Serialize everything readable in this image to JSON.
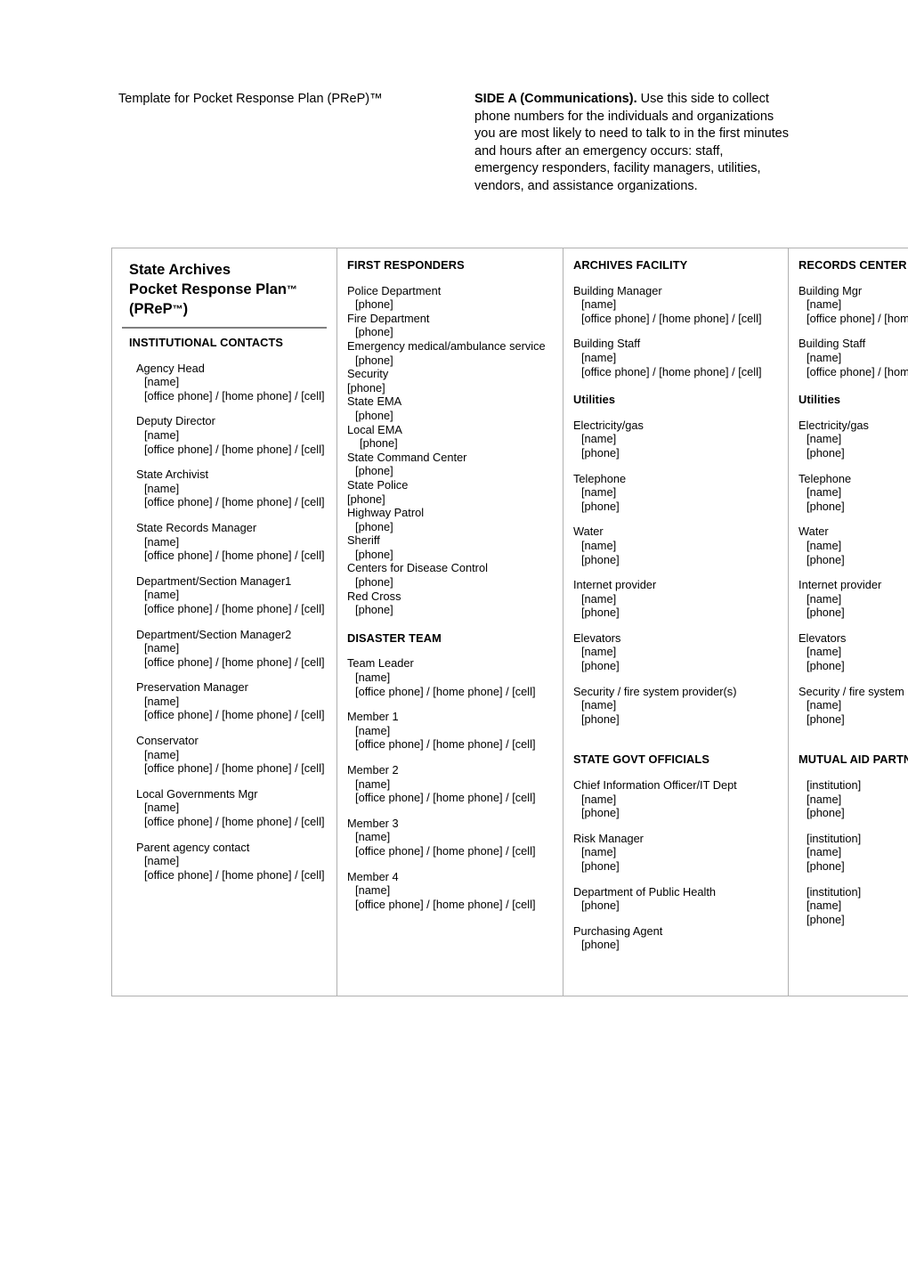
{
  "header": {
    "left_title": "Template for Pocket Response Plan (PReP)™",
    "side_label": "SIDE A (Communications).",
    "side_text": " Use this side to collect phone numbers for the individuals and organizations you are most likely to need to talk to in the first minutes and hours after an emergency occurs: staff, emergency responders, facility managers, utilities, vendors, and assistance organizations."
  },
  "card": {
    "title_line_1": "State Archives",
    "title_line_2": "Pocket Response Plan",
    "title_line_2_tm": "™",
    "title_line_3_open": "(PReP",
    "title_line_3_tm": "™",
    "title_line_3_close": ")"
  },
  "columns": [
    {
      "id": "institutional-contacts",
      "heading": "INSTITUTIONAL CONTACTS",
      "entries": [
        {
          "label": "Agency Head",
          "lines": [
            "[name]",
            "[office phone] / [home phone] / [cell]"
          ]
        },
        {
          "label": "Deputy Director",
          "lines": [
            "[name]",
            "[office phone] / [home phone] / [cell]"
          ]
        },
        {
          "label": "State Archivist",
          "lines": [
            "[name]",
            "[office phone] / [home phone] / [cell]"
          ]
        },
        {
          "label": "State Records Manager",
          "lines": [
            "[name]",
            "[office phone] / [home phone] / [cell]"
          ]
        },
        {
          "label": "Department/Section Manager1",
          "lines": [
            "[name]",
            "[office phone] / [home phone] / [cell]"
          ]
        },
        {
          "label": "Department/Section Manager2",
          "lines": [
            "[name]",
            "[office phone] / [home phone] / [cell]"
          ]
        },
        {
          "label": "Preservation Manager",
          "lines": [
            "[name]",
            "[office phone] / [home phone] / [cell]"
          ]
        },
        {
          "label": "Conservator",
          "lines": [
            "[name]",
            "[office phone] / [home phone] / [cell]"
          ]
        },
        {
          "label": "Local Governments Mgr",
          "lines": [
            "[name]",
            "[office phone] / [home phone] / [cell]"
          ]
        },
        {
          "label": "Parent agency contact",
          "lines": [
            "[name]",
            "[office phone] / [home phone] / [cell]"
          ]
        }
      ]
    },
    {
      "id": "first-responders",
      "heading": "FIRST RESPONDERS",
      "entries": [
        {
          "label": "Police Department",
          "lines": [
            "[phone]"
          ]
        },
        {
          "label": "Fire Department",
          "lines": [
            "[phone]"
          ]
        },
        {
          "label": "Emergency medical/ambulance service",
          "lines": [
            "[phone]"
          ]
        },
        {
          "label": "Security",
          "lines": [
            "[phone]"
          ],
          "flush": true
        },
        {
          "label": "State EMA",
          "lines": [
            "[phone]"
          ]
        },
        {
          "label": "Local EMA",
          "lines": [
            "[phone]"
          ],
          "deep": true
        },
        {
          "label": "State Command Center",
          "lines": [
            "[phone]"
          ]
        },
        {
          "label": "State Police",
          "lines": [
            "[phone]"
          ],
          "flush": true
        },
        {
          "label": "Highway Patrol",
          "lines": [
            "[phone]"
          ]
        },
        {
          "label": "Sheriff",
          "lines": [
            "[phone]"
          ]
        },
        {
          "label": "Centers for Disease Control",
          "lines": [
            "[phone]"
          ]
        },
        {
          "label": "Red Cross",
          "lines": [
            "[phone]"
          ]
        }
      ],
      "heading_2": "DISASTER TEAM",
      "entries_2": [
        {
          "label": "Team Leader",
          "lines": [
            "[name]",
            "[office phone] / [home phone] / [cell]"
          ]
        },
        {
          "label": "Member 1",
          "lines": [
            "[name]",
            "[office phone] / [home phone] / [cell]"
          ]
        },
        {
          "label": "Member 2",
          "lines": [
            "[name]",
            "[office phone] / [home phone] / [cell]"
          ]
        },
        {
          "label": "Member 3",
          "lines": [
            "[name]",
            "[office phone] / [home phone] / [cell]"
          ]
        },
        {
          "label": "Member 4",
          "lines": [
            "[name]",
            "[office phone] / [home phone] / [cell]"
          ]
        }
      ]
    },
    {
      "id": "archives-facility",
      "heading": "ARCHIVES FACILITY",
      "entries": [
        {
          "label": "Building Manager",
          "lines": [
            "[name]",
            "[office phone] / [home phone] / [cell]"
          ]
        },
        {
          "label": "Building Staff",
          "lines": [
            "[name]",
            "[office phone] / [home phone] / [cell]"
          ]
        }
      ],
      "subheading": "Utilities",
      "entries_utilities": [
        {
          "label": "Electricity/gas",
          "lines": [
            "[name]",
            "[phone]"
          ]
        },
        {
          "label": "Telephone",
          "lines": [
            "[name]",
            "[phone]"
          ]
        },
        {
          "label": "Water",
          "lines": [
            "[name]",
            "[phone]"
          ]
        },
        {
          "label": "Internet provider",
          "lines": [
            "[name]",
            "[phone]"
          ]
        },
        {
          "label": "Elevators",
          "lines": [
            "[name]",
            "[phone]"
          ]
        },
        {
          "label": "Security / fire system provider(s)",
          "lines": [
            "[name]",
            "[phone]"
          ]
        }
      ],
      "heading_2": "STATE GOVT OFFICIALS",
      "entries_2": [
        {
          "label": "Chief Information Officer/IT Dept",
          "lines": [
            "[name]",
            "[phone]"
          ]
        },
        {
          "label": "Risk Manager",
          "lines": [
            "[name]",
            "[phone]"
          ]
        },
        {
          "label": "Department of Public Health",
          "lines": [
            "[phone]"
          ]
        },
        {
          "label": "Purchasing Agent",
          "lines": [
            "[phone]"
          ]
        }
      ]
    },
    {
      "id": "records-center",
      "heading": "RECORDS CENTER",
      "entries": [
        {
          "label": "Building Mgr",
          "lines": [
            "[name]",
            "[office phone] / [home phone] / [cell]"
          ]
        },
        {
          "label": "Building Staff",
          "lines": [
            "[name]",
            "[office phone] / [home phone] / [cell]"
          ]
        }
      ],
      "subheading": "Utilities",
      "entries_utilities": [
        {
          "label": "Electricity/gas",
          "lines": [
            "[name]",
            "[phone]"
          ]
        },
        {
          "label": "Telephone",
          "lines": [
            "[name]",
            "[phone]"
          ]
        },
        {
          "label": "Water",
          "lines": [
            "[name]",
            "[phone]"
          ]
        },
        {
          "label": "Internet provider",
          "lines": [
            "[name]",
            "[phone]"
          ]
        },
        {
          "label": "Elevators",
          "lines": [
            "[name]",
            "[phone]"
          ]
        },
        {
          "label": "Security / fire system provider(s)",
          "lines": [
            "[name]",
            "[phone]"
          ]
        }
      ],
      "heading_2": "MUTUAL AID PARTNERS",
      "entries_2": [
        {
          "lines": [
            "[institution]",
            "[name]",
            "[phone]"
          ],
          "indented": true
        },
        {
          "lines": [
            "[institution]",
            "[name]",
            "[phone]"
          ],
          "indented": true
        },
        {
          "lines": [
            "[institution]",
            "[name]",
            "[phone]"
          ],
          "indented": true
        }
      ]
    }
  ]
}
